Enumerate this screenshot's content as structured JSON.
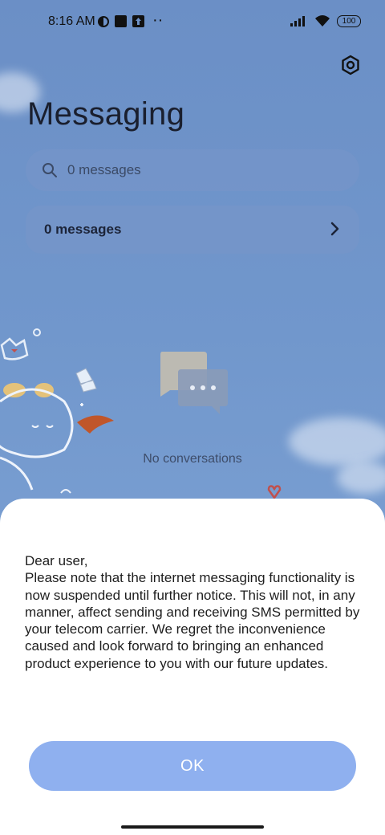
{
  "status_bar": {
    "time": "8:16 AM",
    "battery": "100",
    "dots": "··"
  },
  "header": {
    "title": "Messaging"
  },
  "search": {
    "placeholder": "0 messages"
  },
  "summary_card": {
    "label": "0 messages"
  },
  "empty_state": {
    "text": "No conversations"
  },
  "dialog": {
    "greeting": "Dear user,",
    "body": "Please note that the internet messaging functionality is now suspended until further notice. This will not, in any manner, affect sending and receiving SMS permitted by your telecom carrier. We regret the inconvenience caused and look forward to bringing an enhanced product experience to you with our future updates.",
    "ok_label": "OK"
  },
  "colors": {
    "background": "#7197cc",
    "ok_button": "#8fb0ef",
    "sheet": "#ffffff"
  }
}
